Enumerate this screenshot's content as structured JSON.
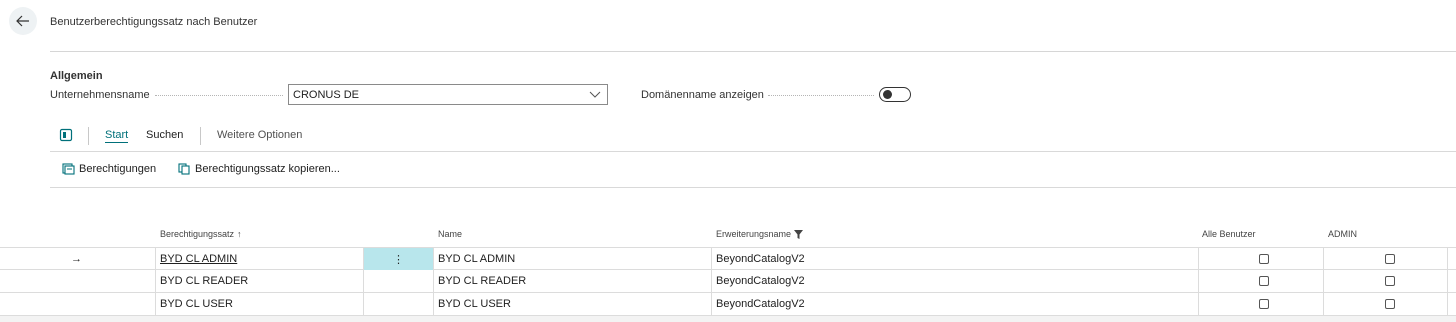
{
  "page": {
    "title": "Benutzerberechtigungssatz nach Benutzer"
  },
  "general": {
    "group_title": "Allgemein",
    "company_label": "Unternehmensname",
    "company_value": "CRONUS DE",
    "domain_label": "Domänenname anzeigen",
    "domain_toggle": false
  },
  "actionbar": {
    "tabs": [
      "Start",
      "Suchen",
      "Weitere Optionen"
    ],
    "active_tab": "Start",
    "actions": [
      "Berechtigungen",
      "Berechtigungssatz kopieren..."
    ]
  },
  "table": {
    "headers": {
      "permission_set": "Berechtigungssatz",
      "sort_indicator": "↑",
      "name": "Name",
      "extension": "Erweiterungsname",
      "all_users": "Alle Benutzer",
      "admin": "ADMIN"
    },
    "rows": [
      {
        "current": true,
        "permission_set": "BYD CL ADMIN",
        "name": "BYD CL ADMIN",
        "extension": "BeyondCatalogV2",
        "all_users": false,
        "admin": false
      },
      {
        "current": false,
        "permission_set": "BYD CL READER",
        "name": "BYD CL READER",
        "extension": "BeyondCatalogV2",
        "all_users": false,
        "admin": false
      },
      {
        "current": false,
        "permission_set": "BYD CL USER",
        "name": "BYD CL USER",
        "extension": "BeyondCatalogV2",
        "all_users": false,
        "admin": false
      }
    ],
    "row_marker": "→",
    "context_menu_glyph": "⋮"
  },
  "colors": {
    "accent": "#00707a",
    "selected_cell": "#b8e6ec"
  }
}
